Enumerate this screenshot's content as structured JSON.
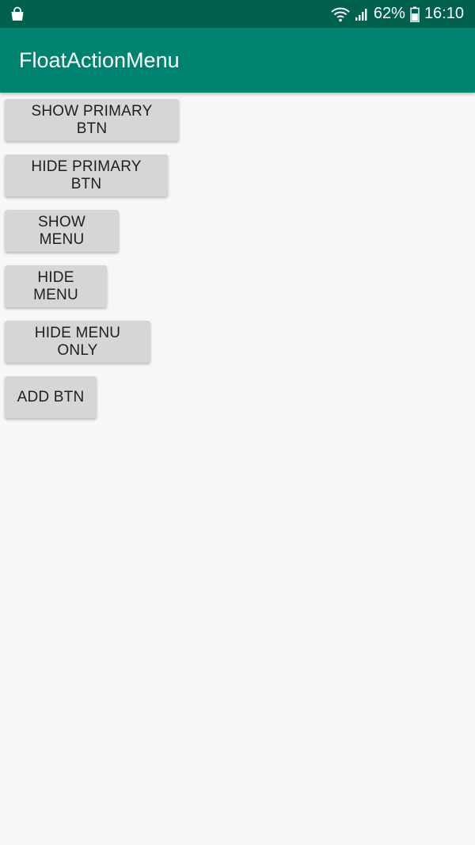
{
  "status_bar": {
    "left_icon": "shopping-bag-icon",
    "wifi_icon": "wifi-icon",
    "signal_icon": "signal-icon",
    "battery_percent": "62%",
    "battery_icon": "battery-icon",
    "time": "16:10"
  },
  "app_bar": {
    "title": "FloatActionMenu"
  },
  "buttons": [
    {
      "label": "SHOW PRIMARY BTN"
    },
    {
      "label": "HIDE PRIMARY BTN"
    },
    {
      "label": "SHOW MENU"
    },
    {
      "label": "HIDE MENU"
    },
    {
      "label": "HIDE MENU ONLY"
    },
    {
      "label": "ADD BTN"
    }
  ],
  "colors": {
    "status_bar": "#00614f",
    "app_bar": "#008270",
    "background": "#f7f7f8",
    "button": "#d6d6d6",
    "button_text": "#1f1f1f"
  }
}
